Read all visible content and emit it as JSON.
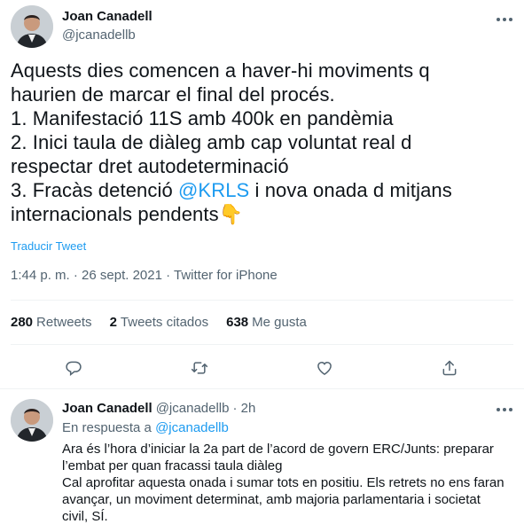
{
  "main_tweet": {
    "author_name": "Joan Canadell",
    "author_handle": "@jcanadellb",
    "text_before_mention": "Aquests dies comencen a haver-hi moviments q\nhaurien de marcar el final del procés.\n1. Manifestació 11S amb 400k en pandèmia\n2. Inici taula de diàleg amb cap voluntat real d\nrespectar dret autodeterminació\n3. Fracàs detenció ",
    "mention": "@KRLS",
    "text_after_mention": " i nova onada d mitjans\ninternacionals pendents",
    "emoji": "👇",
    "translate_label": "Traducir Tweet",
    "timestamp": "1:44 p. m. · 26 sept. 2021 · Twitter for iPhone",
    "stats": {
      "retweets_count": "280",
      "retweets_label": "Retweets",
      "quotes_count": "2",
      "quotes_label": "Tweets citados",
      "likes_count": "638",
      "likes_label": "Me gusta"
    }
  },
  "reply_tweet": {
    "author_name": "Joan Canadell",
    "author_handle": "@jcanadellb",
    "time": "· 2h",
    "in_reply_prefix": "En respuesta a",
    "in_reply_handle": "@jcanadellb",
    "text": "Ara és l’hora d’iniciar la 2a part de l’acord de govern ERC/Junts: preparar\nl’embat per quan fracassi taula diàleg\nCal aprofitar aquesta onada i sumar tots en positiu. Els retrets no ens faran\navançar, un moviment determinat, amb majoria parlamentaria i societat\ncivil, SÍ."
  },
  "icons": {
    "more": "more-icon",
    "reply": "reply-icon",
    "retweet": "retweet-icon",
    "like": "like-icon",
    "share": "share-icon"
  },
  "colors": {
    "accent": "#1d9bf0",
    "secondary_text": "#536471",
    "divider": "#eff3f4"
  }
}
